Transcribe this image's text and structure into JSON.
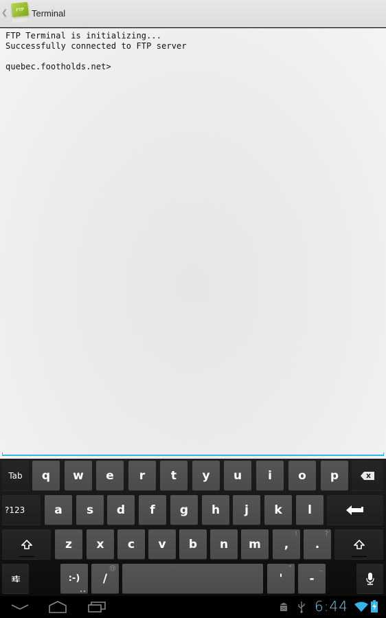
{
  "action_bar": {
    "title": "Terminal",
    "app_icon_label": "FTP"
  },
  "terminal": {
    "lines": [
      "FTP Terminal is initializing...",
      "Successfully connected to FTP server",
      "",
      "quebec.footholds.net>"
    ]
  },
  "keyboard": {
    "row1": {
      "tab": "Tab",
      "keys": [
        "q",
        "w",
        "e",
        "r",
        "t",
        "y",
        "u",
        "i",
        "o",
        "p"
      ],
      "backspace_icon": "backspace-icon"
    },
    "row2": {
      "symbols": "?123",
      "keys": [
        "a",
        "s",
        "d",
        "f",
        "g",
        "h",
        "j",
        "k",
        "l"
      ],
      "enter_icon": "enter-icon"
    },
    "row3": {
      "shift_icon": "shift-icon",
      "keys": [
        "z",
        "x",
        "c",
        "v",
        "b",
        "n",
        "m"
      ],
      "comma": ",",
      "comma_hint": "!",
      "period": ".",
      "period_hint": "?"
    },
    "row4": {
      "settings_icon": "settings-sliders-icon",
      "smiley": ":-)",
      "slash": "/",
      "slash_hint": "@",
      "space": "",
      "apostrophe": "'",
      "apostrophe_hint": "\"",
      "dash": "-",
      "dash_hint": "_",
      "mic_icon": "microphone-icon"
    }
  },
  "status_bar": {
    "time": "6:44",
    "icons": [
      "android-debug-icon",
      "usb-icon",
      "wifi-icon",
      "battery-charging-icon"
    ]
  },
  "nav_bar": {
    "buttons": [
      "back-hide-keyboard",
      "home",
      "recent-apps"
    ]
  },
  "colors": {
    "accent": "#33b5e5",
    "clock": "#7ec8e3",
    "key_bg": "#505050",
    "fn_key_bg": "#222222"
  }
}
